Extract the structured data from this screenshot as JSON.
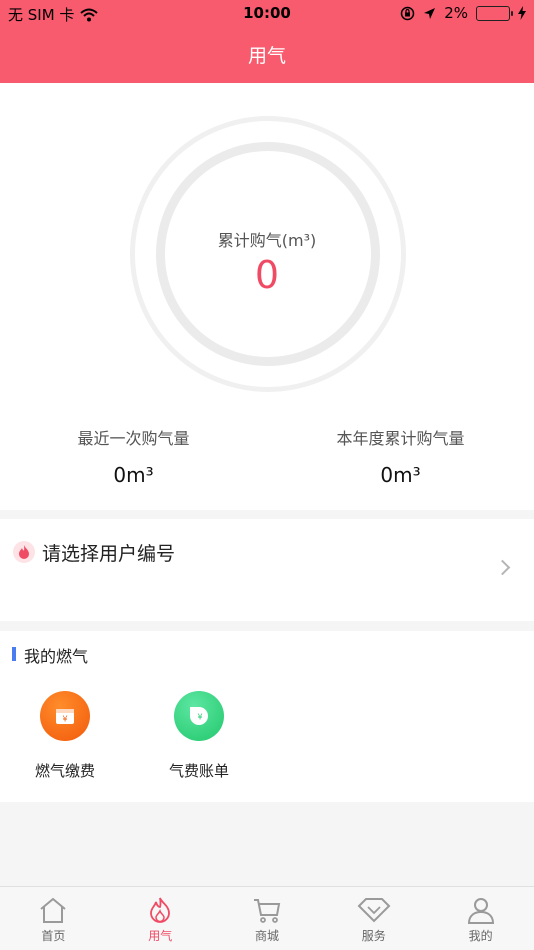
{
  "status_bar": {
    "carrier": "无 SIM 卡",
    "time": "10:00",
    "battery": "2%"
  },
  "nav": {
    "title": "用气"
  },
  "summary": {
    "total_label": "累计购气(m³)",
    "total_value": "0",
    "last_purchase_label": "最近一次购气量",
    "last_purchase_value": "0m³",
    "year_total_label": "本年度累计购气量",
    "year_total_value": "0m³"
  },
  "account": {
    "prompt": "请选择用户编号"
  },
  "my_gas": {
    "title": "我的燃气",
    "tiles": [
      {
        "label": "燃气缴费",
        "icon": "payment-icon",
        "color": "#fb6d15"
      },
      {
        "label": "气费账单",
        "icon": "bill-icon",
        "color": "#2fd67f"
      }
    ]
  },
  "tabs": [
    {
      "label": "首页",
      "icon": "home-icon"
    },
    {
      "label": "用气",
      "icon": "flame-icon",
      "active": true
    },
    {
      "label": "商城",
      "icon": "cart-icon"
    },
    {
      "label": "服务",
      "icon": "diamond-icon"
    },
    {
      "label": "我的",
      "icon": "user-icon"
    }
  ],
  "colors": {
    "brand": "#f85a6e",
    "accent": "#f04b64",
    "section_marker": "#4a7ef0"
  }
}
